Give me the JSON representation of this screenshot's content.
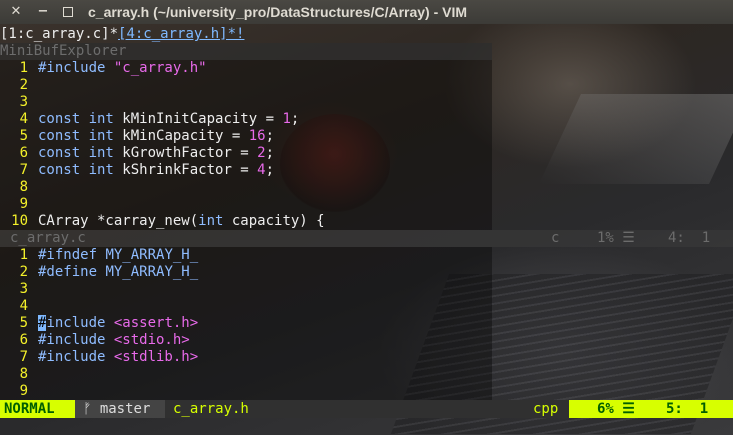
{
  "window": {
    "title": "c_array.h (~/university_pro/DataStructures/C/Array) - VIM",
    "close_glyph": "✕",
    "min_glyph": "−"
  },
  "buftabs": {
    "tab1": "[1:c_array.c]*",
    "tab2": "[4:c_array.h]*!"
  },
  "minibuf_title": "MiniBufExplorer",
  "top_pane": {
    "lines": [
      {
        "n": "1",
        "parts": [
          [
            "pp",
            "#include "
          ],
          [
            "str",
            "\"c_array.h\""
          ]
        ]
      },
      {
        "n": "2",
        "parts": []
      },
      {
        "n": "3",
        "parts": []
      },
      {
        "n": "4",
        "parts": [
          [
            "kw",
            "const int "
          ],
          [
            "ident",
            "kMinInitCapacity = "
          ],
          [
            "num",
            "1"
          ],
          [
            "ident",
            ";"
          ]
        ]
      },
      {
        "n": "5",
        "parts": [
          [
            "kw",
            "const int "
          ],
          [
            "ident",
            "kMinCapacity = "
          ],
          [
            "num",
            "16"
          ],
          [
            "ident",
            ";"
          ]
        ]
      },
      {
        "n": "6",
        "parts": [
          [
            "kw",
            "const int "
          ],
          [
            "ident",
            "kGrowthFactor = "
          ],
          [
            "num",
            "2"
          ],
          [
            "ident",
            ";"
          ]
        ]
      },
      {
        "n": "7",
        "parts": [
          [
            "kw",
            "const int "
          ],
          [
            "ident",
            "kShrinkFactor = "
          ],
          [
            "num",
            "4"
          ],
          [
            "ident",
            ";"
          ]
        ]
      },
      {
        "n": "8",
        "parts": []
      },
      {
        "n": "9",
        "parts": []
      },
      {
        "n": "10",
        "parts": [
          [
            "ident",
            "CArray *carray_new("
          ],
          [
            "kw",
            "int"
          ],
          [
            "ident",
            " capacity) {"
          ]
        ]
      }
    ]
  },
  "inactive_status": {
    "file": "c_array.c",
    "ftype": "c",
    "pct": "1% ☰",
    "pos": "4:  1"
  },
  "bottom_pane": {
    "lines": [
      {
        "n": "1",
        "parts": [
          [
            "pp",
            "#ifndef "
          ],
          [
            "kw",
            "MY_ARRAY_H_"
          ]
        ]
      },
      {
        "n": "2",
        "parts": [
          [
            "pp",
            "#define "
          ],
          [
            "kw",
            "MY_ARRAY_H_"
          ]
        ]
      },
      {
        "n": "3",
        "parts": []
      },
      {
        "n": "4",
        "parts": []
      },
      {
        "n": "5",
        "parts": [
          [
            "cursor",
            "#"
          ],
          [
            "pp",
            "include "
          ],
          [
            "str",
            "<assert.h>"
          ]
        ]
      },
      {
        "n": "6",
        "parts": [
          [
            "pp",
            "#include "
          ],
          [
            "str",
            "<stdio.h>"
          ]
        ]
      },
      {
        "n": "7",
        "parts": [
          [
            "pp",
            "#include "
          ],
          [
            "str",
            "<stdlib.h>"
          ]
        ]
      },
      {
        "n": "8",
        "parts": []
      },
      {
        "n": "9",
        "parts": []
      }
    ]
  },
  "statusline": {
    "mode": "NORMAL",
    "branch": "ᚠ master",
    "file": "c_array.h",
    "ftype": "cpp",
    "pct": "6% ☰",
    "pos": "5:  1"
  },
  "colors": {
    "accent": "#d7ff00",
    "line_numbers": "#f4f12a",
    "keyword": "#8fbcff",
    "string": "#e86aea"
  }
}
